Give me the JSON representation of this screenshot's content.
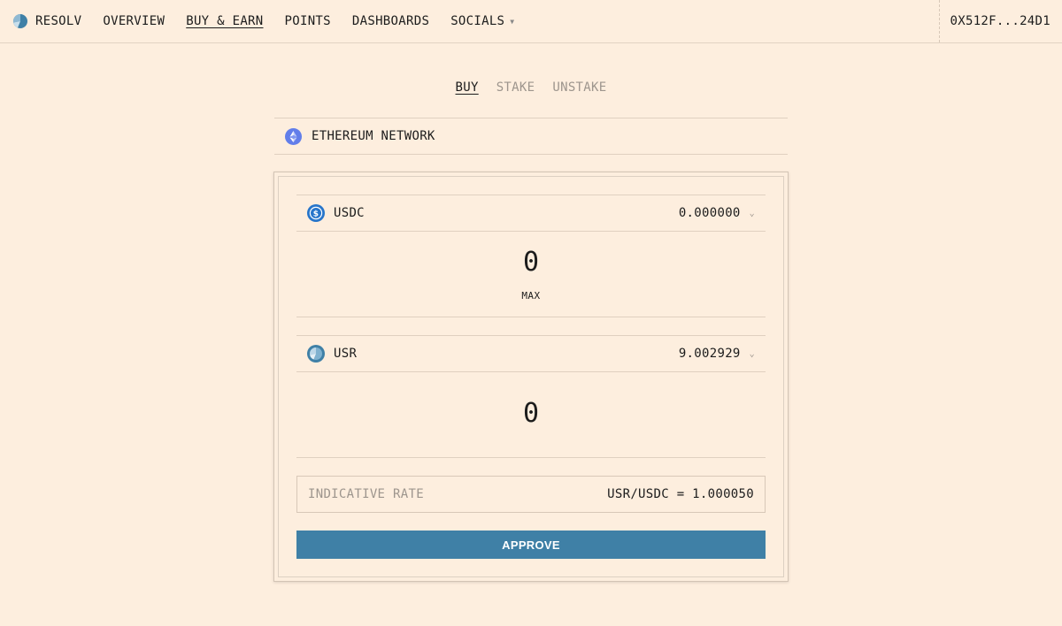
{
  "brand": {
    "name": "RESOLV"
  },
  "nav": {
    "items": [
      {
        "label": "OVERVIEW"
      },
      {
        "label": "BUY & EARN"
      },
      {
        "label": "POINTS"
      },
      {
        "label": "DASHBOARDS"
      },
      {
        "label": "SOCIALS"
      }
    ],
    "active": "BUY & EARN"
  },
  "wallet": {
    "address": "0X512F...24D1"
  },
  "mode_tabs": [
    {
      "label": "BUY"
    },
    {
      "label": "STAKE"
    },
    {
      "label": "UNSTAKE"
    }
  ],
  "active_mode": "BUY",
  "network": {
    "label": "ETHEREUM NETWORK",
    "icon": "ethereum-icon"
  },
  "from_token": {
    "symbol": "USDC",
    "balance": "0.000000",
    "amount": "0",
    "max_label": "MAX",
    "icon": "usdc-icon"
  },
  "to_token": {
    "symbol": "USR",
    "balance": "9.002929",
    "amount": "0",
    "icon": "usr-icon"
  },
  "rate": {
    "label": "INDICATIVE RATE",
    "value": "USR/USDC = 1.000050"
  },
  "approve_label": "APPROVE",
  "colors": {
    "background": "#fdeede",
    "accent": "#3f80a6",
    "muted_text": "#9d958d",
    "ethereum": "#627eea",
    "usdc": "#2775ca"
  }
}
